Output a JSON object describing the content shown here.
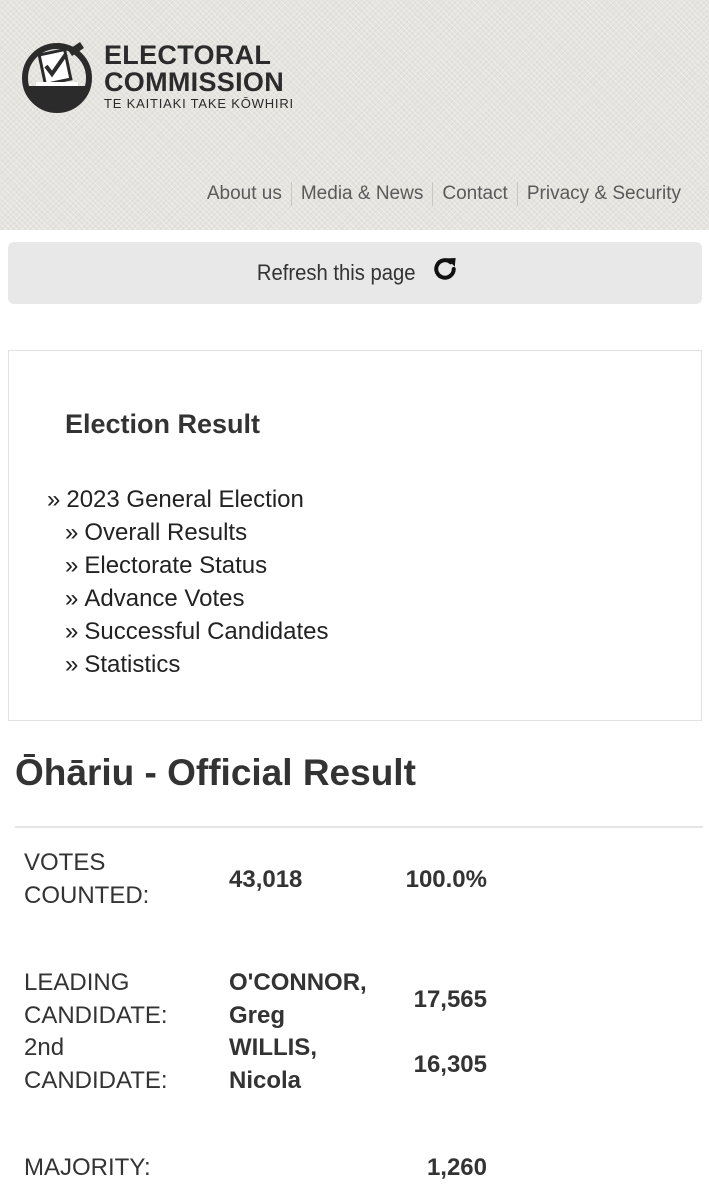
{
  "header": {
    "logo": {
      "title_line1": "ELECTORAL",
      "title_line2": "COMMISSION",
      "subtitle": "TE KAITIAKI TAKE KŌWHIRI"
    },
    "nav": [
      "About us",
      "Media & News",
      "Contact",
      "Privacy & Security"
    ]
  },
  "refresh": {
    "label": "Refresh this page",
    "icon": "refresh-icon"
  },
  "election": {
    "heading": "Election Result",
    "links": [
      {
        "label": "2023 General Election",
        "level": 0
      },
      {
        "label": "Overall Results",
        "level": 1
      },
      {
        "label": "Electorate Status",
        "level": 1
      },
      {
        "label": "Advance Votes",
        "level": 1
      },
      {
        "label": "Successful Candidates",
        "level": 1
      },
      {
        "label": "Statistics",
        "level": 1
      }
    ],
    "bullet": "»"
  },
  "result": {
    "title": "Ōhāriu - Official Result",
    "votes_counted": {
      "label_line1": "VOTES",
      "label_line2": "COUNTED:",
      "value": "43,018",
      "percent": "100.0%"
    },
    "leading": {
      "label_line1": "LEADING",
      "label_line2": "CANDIDATE:",
      "name_line1": "O'CONNOR,",
      "name_line2": "Greg",
      "votes": "17,565"
    },
    "second": {
      "label_line1": "2nd",
      "label_line2": "CANDIDATE:",
      "name_line1": "WILLIS,",
      "name_line2": "Nicola",
      "votes": "16,305"
    },
    "majority": {
      "label": "MAJORITY:",
      "value": "1,260"
    }
  }
}
